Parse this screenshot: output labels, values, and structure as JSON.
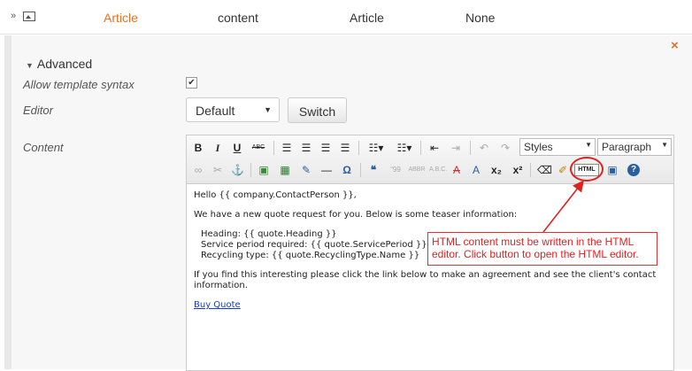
{
  "row": {
    "expand_glyph": "»",
    "cells": [
      "Article",
      "content",
      "Article",
      "None"
    ]
  },
  "panel": {
    "close_glyph": "×",
    "section_title": "Advanced",
    "allow_template_label": "Allow template syntax",
    "allow_template_checked": true,
    "check_glyph": "✔",
    "editor_label": "Editor",
    "editor_value": "Default",
    "switch_label": "Switch",
    "content_label": "Content"
  },
  "toolbar": {
    "bold": "B",
    "italic": "I",
    "underline": "U",
    "strike": "ABC",
    "styles_value": "Styles",
    "format_value": "Paragraph",
    "html_label": "HTML",
    "quote_glyph": "❝",
    "help_glyph": "?"
  },
  "content": {
    "greeting": "Hello {{ company.ContactPerson }},",
    "intro": "We have a new quote request for you. Below is some teaser information:",
    "heading_line": "Heading: {{ quote.Heading }}",
    "service_line": "Service period required: {{ quote.ServicePeriod }}",
    "recycling_line": "Recycling type: {{ quote.RecyclingType.Name }}",
    "outro": "If you find this interesting please click the link below to make an agreement and see the client's contact information.",
    "link_text": "Buy Quote"
  },
  "annotation": {
    "text": "HTML content must be written in the HTML editor. Click button to open the HTML editor.",
    "color": "#dd2222"
  },
  "colors": {
    "accent": "#e8711f"
  }
}
